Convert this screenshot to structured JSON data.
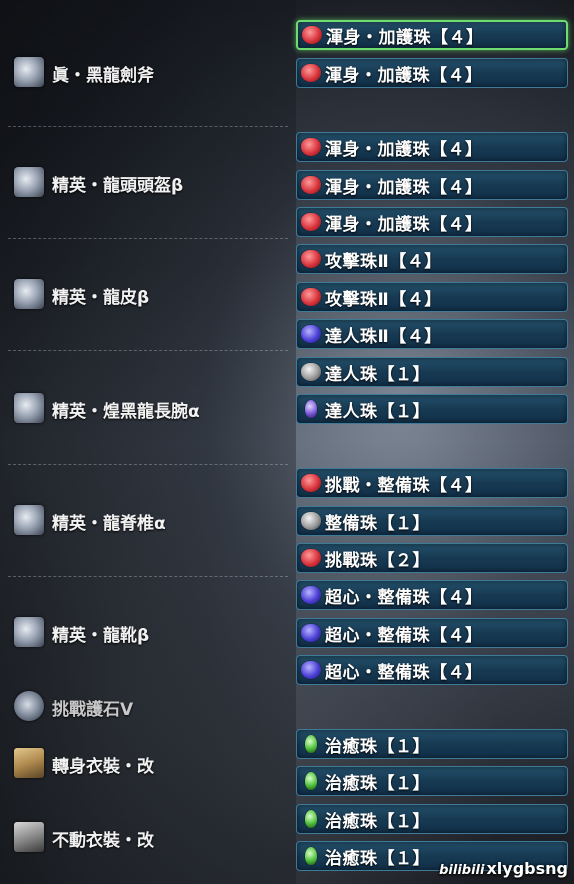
{
  "equipment": [
    {
      "name": "眞・黑龍劍斧",
      "icon": "great-sword-icon"
    },
    {
      "name": "精英・龍頭頭盔β",
      "icon": "helmet-icon"
    },
    {
      "name": "精英・龍皮β",
      "icon": "chest-armor-icon"
    },
    {
      "name": "精英・煌黑龍長腕α",
      "icon": "arm-armor-icon"
    },
    {
      "name": "精英・龍脊椎α",
      "icon": "waist-armor-icon"
    },
    {
      "name": "精英・龍靴β",
      "icon": "leg-armor-icon"
    },
    {
      "name": "挑戰護石Ⅴ",
      "icon": "talisman-icon"
    },
    {
      "name": "轉身衣裝・改",
      "icon": "mantle-icon"
    },
    {
      "name": "不動衣裝・改",
      "icon": "mantle-icon"
    }
  ],
  "slots": [
    {
      "label": "渾身・加護珠【４】",
      "jewel": "red",
      "selected": true
    },
    {
      "label": "渾身・加護珠【４】",
      "jewel": "red",
      "selected": false
    },
    {
      "label": "渾身・加護珠【４】",
      "jewel": "red",
      "selected": false
    },
    {
      "label": "渾身・加護珠【４】",
      "jewel": "red",
      "selected": false
    },
    {
      "label": "渾身・加護珠【４】",
      "jewel": "red",
      "selected": false
    },
    {
      "label": "攻擊珠Ⅱ【４】",
      "jewel": "red",
      "selected": false
    },
    {
      "label": "攻擊珠Ⅱ【４】",
      "jewel": "red",
      "selected": false
    },
    {
      "label": "達人珠Ⅱ【４】",
      "jewel": "blue",
      "selected": false
    },
    {
      "label": "達人珠【１】",
      "jewel": "gray",
      "selected": false
    },
    {
      "label": "達人珠【１】",
      "jewel": "purple",
      "selected": false
    },
    {
      "label": "挑戰・整備珠【４】",
      "jewel": "red",
      "selected": false
    },
    {
      "label": "整備珠【１】",
      "jewel": "gray",
      "selected": false
    },
    {
      "label": "挑戰珠【２】",
      "jewel": "red",
      "selected": false
    },
    {
      "label": "超心・整備珠【４】",
      "jewel": "blue",
      "selected": false
    },
    {
      "label": "超心・整備珠【４】",
      "jewel": "blue",
      "selected": false
    },
    {
      "label": "超心・整備珠【４】",
      "jewel": "blue",
      "selected": false
    },
    {
      "label": "治癒珠【１】",
      "jewel": "green",
      "selected": false
    },
    {
      "label": "治癒珠【１】",
      "jewel": "green",
      "selected": false
    },
    {
      "label": "治癒珠【１】",
      "jewel": "green",
      "selected": false
    },
    {
      "label": "治癒珠【１】",
      "jewel": "green",
      "selected": false
    }
  ],
  "watermark": {
    "logo": "bilibili",
    "user": "xlygbsng"
  }
}
